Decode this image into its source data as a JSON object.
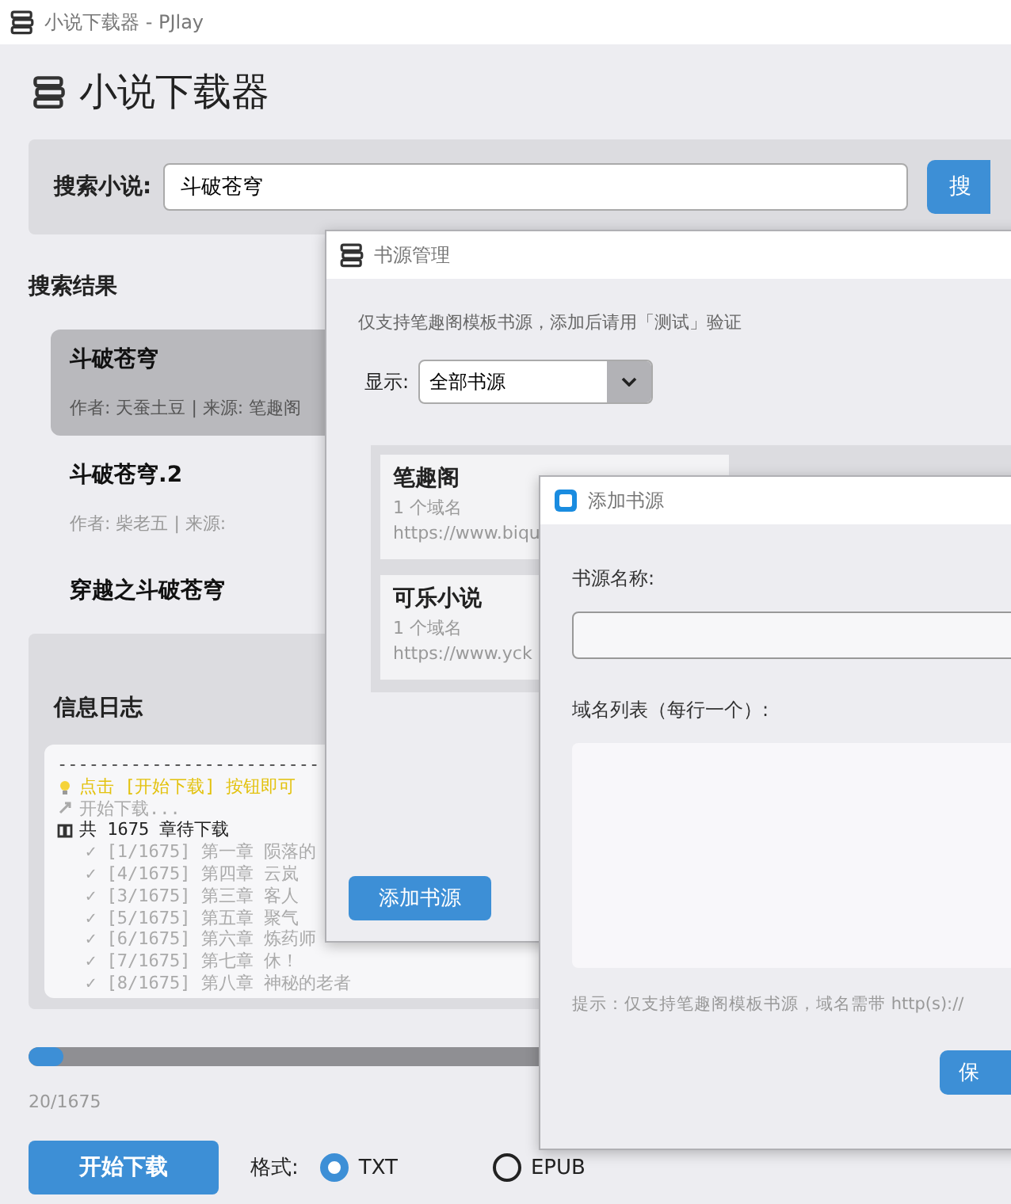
{
  "window": {
    "title": "小说下载器 - PJlay"
  },
  "header": {
    "title": "小说下载器"
  },
  "search": {
    "label": "搜索小说:",
    "value": "斗破苍穹",
    "button": "搜"
  },
  "results": {
    "title": "搜索结果",
    "items": [
      {
        "title": "斗破苍穹",
        "meta": "作者: 天蚕土豆 | 来源: 笔趣阁",
        "selected": true
      },
      {
        "title": "斗破苍穹.2",
        "meta": "作者: 柴老五 | 来源:",
        "selected": false
      },
      {
        "title": "穿越之斗破苍穹",
        "selected": false
      }
    ]
  },
  "log": {
    "title": "信息日志",
    "lines": [
      {
        "kind": "rule",
        "text": "-------------------------"
      },
      {
        "kind": "hint",
        "text": "点击 [开始下载] 按钮即可"
      },
      {
        "kind": "start",
        "text": "开始下载..."
      },
      {
        "kind": "total",
        "text": "共 1675 章待下载"
      },
      {
        "kind": "done",
        "text": "✓ [1/1675] 第一章 陨落的"
      },
      {
        "kind": "done",
        "text": "✓ [4/1675] 第四章 云岚"
      },
      {
        "kind": "done",
        "text": "✓ [3/1675] 第三章 客人"
      },
      {
        "kind": "done",
        "text": "✓ [5/1675] 第五章 聚气"
      },
      {
        "kind": "done",
        "text": "✓ [6/1675] 第六章 炼药师"
      },
      {
        "kind": "done",
        "text": "✓ [7/1675] 第七章 休！"
      },
      {
        "kind": "done",
        "text": "✓ [8/1675] 第八章 神秘的老者"
      }
    ]
  },
  "progress": {
    "level": 0.012,
    "reading": "20/1675"
  },
  "actions": {
    "start_button": "开始下载",
    "format_label": "格式:",
    "formats": [
      {
        "label": "TXT",
        "selected": true
      },
      {
        "label": "EPUB",
        "selected": false
      }
    ]
  },
  "source_manager": {
    "title": "书源管理",
    "note": "仅支持笔趣阁模板书源，添加后请用「测试」验证",
    "filter_label": "显示:",
    "filter_value": "全部书源",
    "sources": [
      {
        "name": "笔趣阁",
        "count": "1 个域名",
        "url": "https://www.biqu"
      },
      {
        "name": "可乐小说",
        "count": "1 个域名",
        "url": "https://www.yck"
      }
    ],
    "add_button": "添加书源"
  },
  "add_source": {
    "title": "添加书源",
    "name_label": "书源名称:",
    "domains_label": "域名列表（每行一个）:",
    "hint": "提示：仅支持笔趣阁模板书源，域名需带 http(s)://",
    "save_button": "保"
  }
}
